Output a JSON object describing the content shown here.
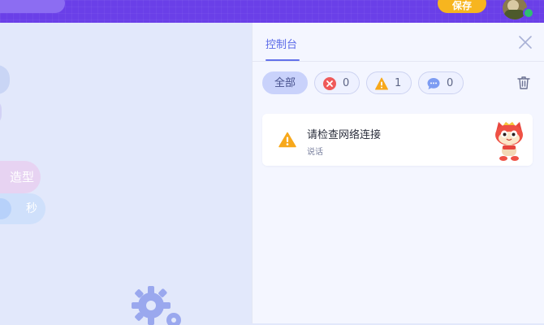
{
  "topbar": {
    "save_label": "保存",
    "avatar_badge_color": "#2fbe72",
    "bar_color": "#6a3fe8",
    "save_color": "#f7b51f"
  },
  "canvas": {
    "block_shape_label": "造型",
    "block_seconds_label": "秒",
    "gear_icon": "gear-icon"
  },
  "console": {
    "tab_label": "控制台",
    "close_icon": "close-icon",
    "trash_icon": "trash-icon",
    "filters": {
      "all_label": "全部",
      "error_count": "0",
      "warning_count": "1",
      "message_count": "0"
    },
    "entries": [
      {
        "level": "warning",
        "title": "请检查网络连接",
        "subtitle": "说话",
        "icon": "warning-icon",
        "sprite_icon": "cat-sprite-icon"
      }
    ],
    "colors": {
      "accent": "#5b6ae8",
      "error": "#ef5a5a",
      "warning": "#f7a81b",
      "message": "#7d9cf2"
    }
  }
}
